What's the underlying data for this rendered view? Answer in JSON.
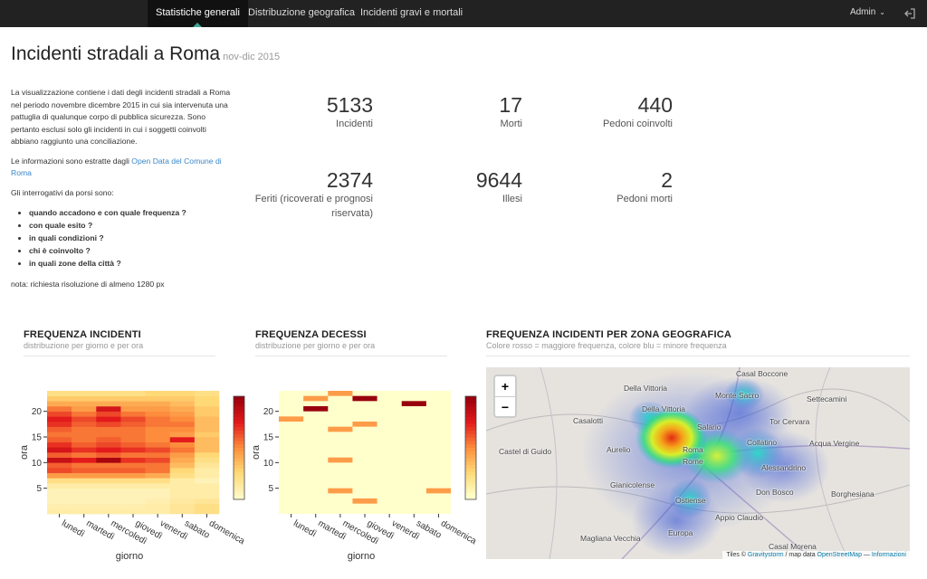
{
  "nav": {
    "tabs": [
      {
        "label": "Statistiche generali",
        "active": true
      },
      {
        "label": "Distribuzione geografica",
        "active": false
      },
      {
        "label": "Incidenti gravi e mortali",
        "active": false
      }
    ],
    "user": "Admin",
    "logout_icon": "logout-icon",
    "accent_color": "#3fa598"
  },
  "header": {
    "title": "Incidenti stradali a Roma",
    "subtitle": "nov-dic 2015"
  },
  "intro": {
    "p1": "La visualizzazione contiene i dati degli incidenti stradali a Roma nel periodo novembre dicembre 2015 in cui sia intervenuta una pattuglia di qualunque corpo di pubblica sicurezza. Sono pertanto esclusi solo gli incidenti in cui i soggetti coinvolti abbiano raggiunto una conciliazione.",
    "p2_prefix": "Le informazioni sono estratte dagli ",
    "p2_link": "Open Data del Comune di Roma",
    "p3": "Gli interrogativi da porsi sono:",
    "questions": [
      "quando accadono e con quale frequenza ?",
      "con quale esito ?",
      "in quali condizioni ?",
      "chi è coinvolto ?",
      "in quali zone della città ?"
    ],
    "note": "nota: richiesta risoluzione di almeno 1280 px"
  },
  "stats": [
    {
      "value": "5133",
      "label": "Incidenti"
    },
    {
      "value": "17",
      "label": "Morti"
    },
    {
      "value": "440",
      "label": "Pedoni coinvolti"
    },
    {
      "value": "2374",
      "label": "Feriti (ricoverati e prognosi riservata)"
    },
    {
      "value": "9644",
      "label": "Illesi"
    },
    {
      "value": "2",
      "label": "Pedoni morti"
    }
  ],
  "panels": {
    "freq": {
      "title": "FREQUENZA INCIDENTI",
      "subtitle": "distribuzione per giorno e per ora"
    },
    "deaths": {
      "title": "FREQUENZA DECESSI",
      "subtitle": "distribuzione per giorno e per ora"
    },
    "geo": {
      "title": "FREQUENZA INCIDENTI PER ZONA GEOGRAFICA",
      "subtitle": "Colore rosso = maggiore frequenza, colore blu = minore frequenza"
    }
  },
  "chart_data": [
    {
      "type": "heatmap",
      "title": "FREQUENZA INCIDENTI",
      "xlabel": "giorno",
      "ylabel": "ora",
      "x": [
        "lunedì",
        "martedì",
        "mercoledì",
        "giovedì",
        "venerdì",
        "sabato",
        "domenica"
      ],
      "y_ticks": [
        5,
        10,
        15,
        20
      ],
      "y_range": [
        0,
        24
      ],
      "colorscale": [
        "#fff8c8",
        "#fed976",
        "#fd8d3c",
        "#e31a1c",
        "#99000d"
      ],
      "values": [
        [
          0.1,
          0.1,
          0.1,
          0.1,
          0.1,
          0.15,
          0.2
        ],
        [
          0.08,
          0.08,
          0.08,
          0.08,
          0.1,
          0.15,
          0.2
        ],
        [
          0.05,
          0.05,
          0.05,
          0.05,
          0.08,
          0.12,
          0.15
        ],
        [
          0.05,
          0.05,
          0.05,
          0.05,
          0.05,
          0.1,
          0.1
        ],
        [
          0.05,
          0.05,
          0.05,
          0.05,
          0.05,
          0.1,
          0.1
        ],
        [
          0.1,
          0.1,
          0.1,
          0.1,
          0.1,
          0.1,
          0.1
        ],
        [
          0.2,
          0.2,
          0.2,
          0.2,
          0.2,
          0.1,
          0.05
        ],
        [
          0.45,
          0.45,
          0.45,
          0.45,
          0.4,
          0.2,
          0.1
        ],
        [
          0.65,
          0.6,
          0.6,
          0.6,
          0.55,
          0.25,
          0.1
        ],
        [
          0.6,
          0.55,
          0.55,
          0.55,
          0.55,
          0.35,
          0.15
        ],
        [
          0.85,
          0.75,
          0.95,
          0.7,
          0.65,
          0.4,
          0.2
        ],
        [
          0.6,
          0.55,
          0.6,
          0.55,
          0.55,
          0.45,
          0.25
        ],
        [
          0.8,
          0.7,
          0.75,
          0.7,
          0.65,
          0.55,
          0.35
        ],
        [
          0.7,
          0.6,
          0.65,
          0.6,
          0.55,
          0.5,
          0.35
        ],
        [
          0.6,
          0.55,
          0.6,
          0.55,
          0.5,
          0.75,
          0.35
        ],
        [
          0.55,
          0.55,
          0.55,
          0.55,
          0.5,
          0.45,
          0.3
        ],
        [
          0.6,
          0.55,
          0.55,
          0.55,
          0.5,
          0.5,
          0.35
        ],
        [
          0.7,
          0.6,
          0.65,
          0.6,
          0.55,
          0.55,
          0.35
        ],
        [
          0.75,
          0.65,
          0.75,
          0.65,
          0.55,
          0.5,
          0.35
        ],
        [
          0.65,
          0.55,
          0.65,
          0.55,
          0.5,
          0.45,
          0.3
        ],
        [
          0.55,
          0.45,
          0.8,
          0.45,
          0.45,
          0.4,
          0.3
        ],
        [
          0.4,
          0.4,
          0.4,
          0.4,
          0.4,
          0.35,
          0.25
        ],
        [
          0.3,
          0.3,
          0.3,
          0.3,
          0.3,
          0.3,
          0.25
        ],
        [
          0.2,
          0.2,
          0.2,
          0.2,
          0.25,
          0.25,
          0.2
        ]
      ]
    },
    {
      "type": "heatmap",
      "title": "FREQUENZA DECESSI",
      "xlabel": "giorno",
      "ylabel": "ora",
      "x": [
        "lunedì",
        "martedì",
        "mercoledì",
        "giovedì",
        "venerdì",
        "sabato",
        "domenica"
      ],
      "y_ticks": [
        5,
        10,
        15,
        20
      ],
      "y_range": [
        0,
        24
      ],
      "colorscale": [
        "#ffffcc",
        "#fed976",
        "#fd8d3c",
        "#e31a1c",
        "#99000d"
      ],
      "cells": [
        {
          "day": 0,
          "hour": 18,
          "value": 0.45
        },
        {
          "day": 1,
          "hour": 20,
          "value": 1.0
        },
        {
          "day": 1,
          "hour": 22,
          "value": 0.45
        },
        {
          "day": 2,
          "hour": 23,
          "value": 0.45
        },
        {
          "day": 2,
          "hour": 16,
          "value": 0.45
        },
        {
          "day": 2,
          "hour": 10,
          "value": 0.45
        },
        {
          "day": 2,
          "hour": 4,
          "value": 0.45
        },
        {
          "day": 3,
          "hour": 22,
          "value": 1.0
        },
        {
          "day": 3,
          "hour": 17,
          "value": 0.45
        },
        {
          "day": 3,
          "hour": 2,
          "value": 0.45
        },
        {
          "day": 5,
          "hour": 21,
          "value": 1.0
        },
        {
          "day": 6,
          "hour": 4,
          "value": 0.45
        }
      ]
    }
  ],
  "map": {
    "zoom_in": "+",
    "zoom_out": "−",
    "places": [
      "Casal Boccone",
      "Della Vittoria",
      "Monte Sacro",
      "Settecamini",
      "Casalotti",
      "Della Vittoria",
      "Salario",
      "Tor Cervara",
      "Castel di Guido",
      "Aurelio",
      "Roma",
      "Collatino",
      "Acqua Vergine",
      "Rome",
      "Alessandrino",
      "Gianicolense",
      "Don Bosco",
      "Borghesiana",
      "Ostiense",
      "Appio Claudio",
      "Magliana Vecchia",
      "Europa",
      "Casal Morena"
    ],
    "attribution_prefix": "Tiles © ",
    "attribution_link1": "Gravitystorm",
    "attribution_mid": " / map data ",
    "attribution_link2": "OpenStreetMap",
    "attribution_sep": " — ",
    "attribution_link3": "Informazioni"
  }
}
